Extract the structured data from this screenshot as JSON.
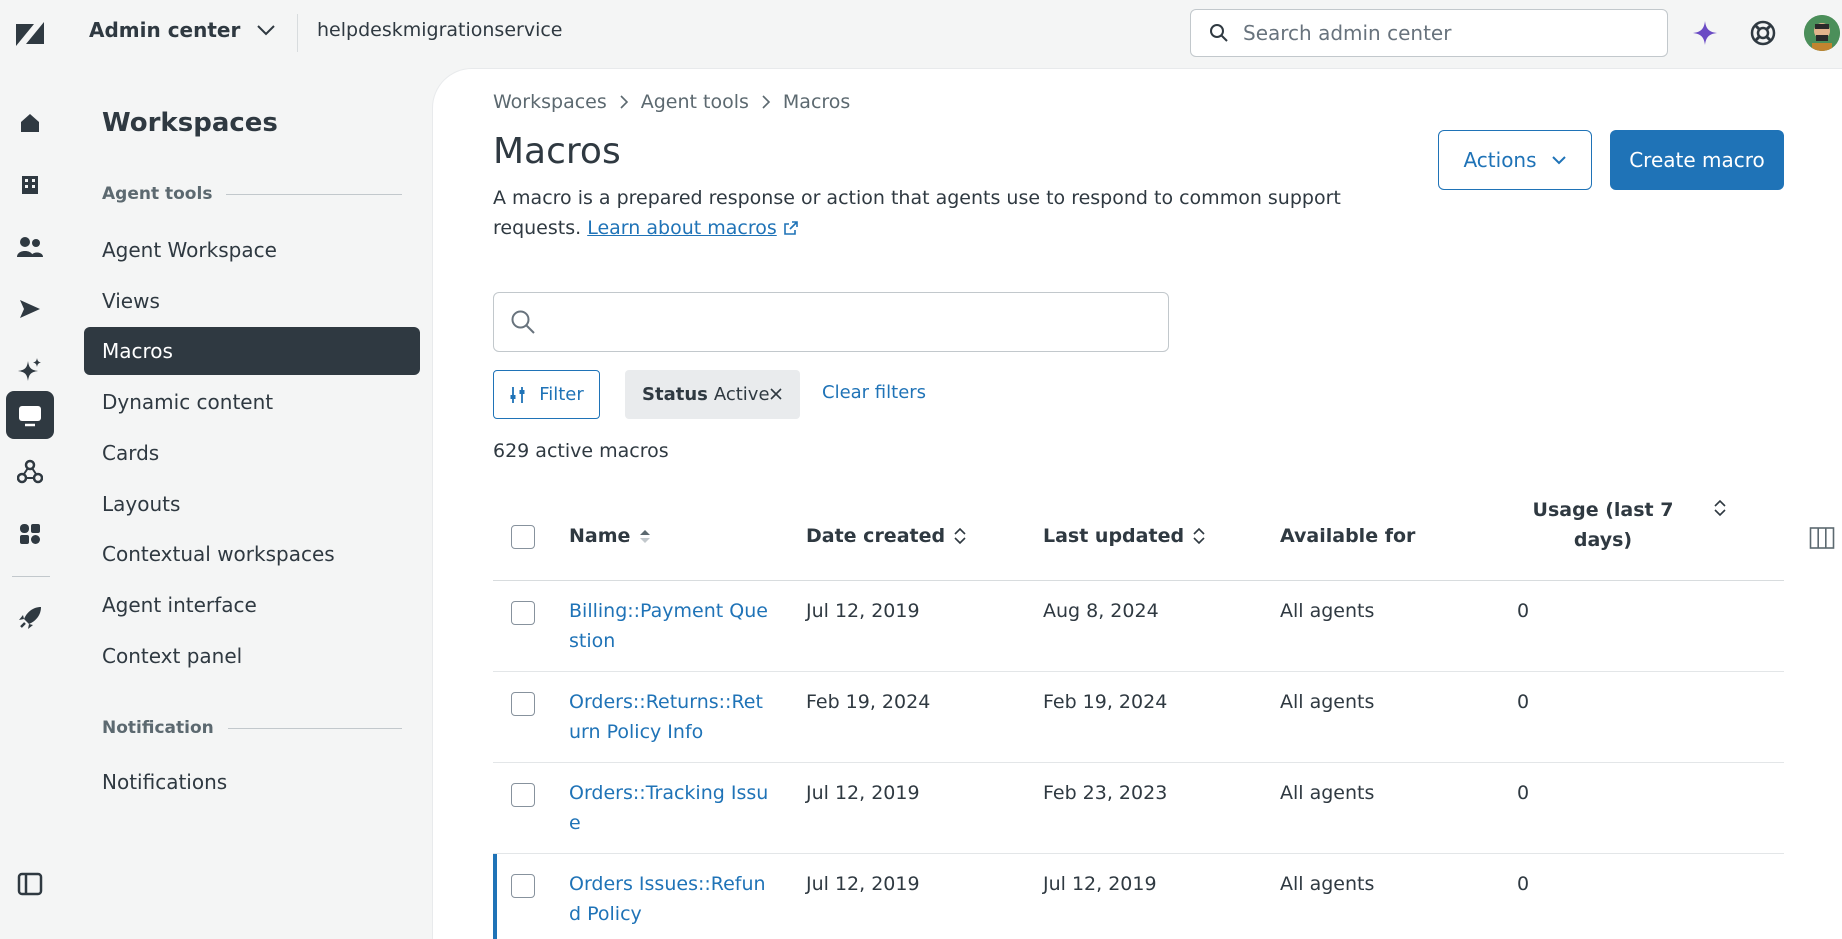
{
  "topbar": {
    "product": "Admin center",
    "subdomain": "helpdeskmigrationservice",
    "search_placeholder": "Search admin center"
  },
  "subnav": {
    "title": "Workspaces",
    "section_agent_tools": "Agent tools",
    "items": [
      "Agent Workspace",
      "Views",
      "Macros",
      "Dynamic content",
      "Cards",
      "Layouts",
      "Contextual workspaces",
      "Agent interface",
      "Context panel"
    ],
    "section_notification": "Notification",
    "notification_items": [
      "Notifications"
    ]
  },
  "main": {
    "breadcrumb": [
      "Workspaces",
      "Agent tools",
      "Macros"
    ],
    "title": "Macros",
    "description": "A macro is a prepared response or action that agents use to respond to common support requests.",
    "learn_link": "Learn about macros",
    "actions_label": "Actions",
    "create_label": "Create macro",
    "search_value": "",
    "filter_label": "Filter",
    "chip_key": "Status",
    "chip_value": "Active",
    "clear_filters": "Clear filters",
    "count": "629 active macros"
  },
  "table": {
    "headers": {
      "name": "Name",
      "date_created": "Date created",
      "last_updated": "Last updated",
      "available_for": "Available for",
      "usage": "Usage (last 7 days)"
    },
    "rows": [
      {
        "name": "Billing::Payment Question",
        "created": "Jul 12, 2019",
        "updated": "Aug 8, 2024",
        "available": "All agents",
        "usage": "0"
      },
      {
        "name": "Orders::Returns::Return Policy Info",
        "created": "Feb 19, 2024",
        "updated": "Feb 19, 2024",
        "available": "All agents",
        "usage": "0"
      },
      {
        "name": "Orders::Tracking Issue",
        "created": "Jul 12, 2019",
        "updated": "Feb 23, 2023",
        "available": "All agents",
        "usage": "0"
      },
      {
        "name": "Orders Issues::Refund Policy",
        "created": "Jul 12, 2019",
        "updated": "Jul 12, 2019",
        "available": "All agents",
        "usage": "0"
      }
    ]
  },
  "colors": {
    "accent": "#1f73b7",
    "sidebar_active": "#2f3941",
    "ai_star": "#6a4bc4"
  }
}
